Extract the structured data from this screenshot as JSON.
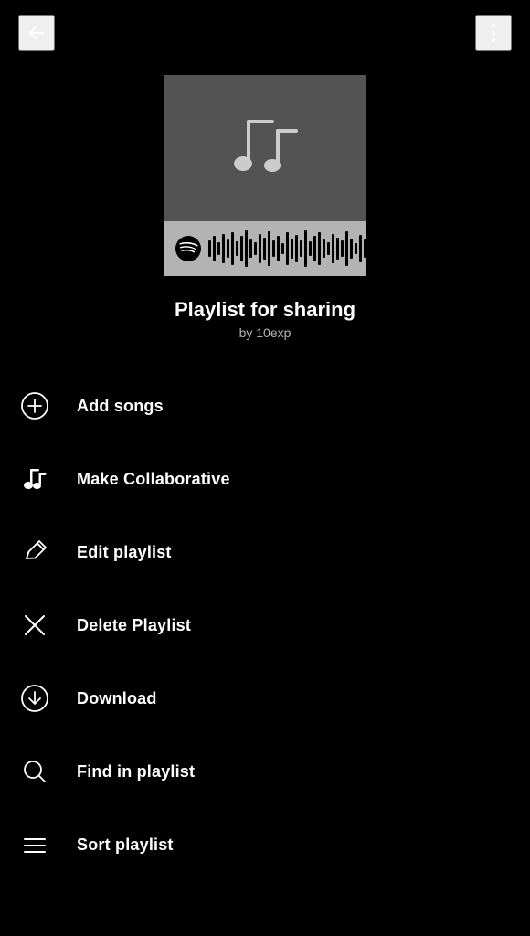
{
  "header": {
    "back_label": "Back",
    "more_label": "More options"
  },
  "playlist": {
    "title": "Playlist for sharing",
    "author": "by 10exp"
  },
  "menu": {
    "items": [
      {
        "id": "add-songs",
        "label": "Add songs",
        "icon": "add-circle-icon"
      },
      {
        "id": "make-collaborative",
        "label": "Make Collaborative",
        "icon": "music-note-icon"
      },
      {
        "id": "edit-playlist",
        "label": "Edit playlist",
        "icon": "pencil-icon"
      },
      {
        "id": "delete-playlist",
        "label": "Delete Playlist",
        "icon": "x-icon"
      },
      {
        "id": "download",
        "label": "Download",
        "icon": "download-icon"
      },
      {
        "id": "find-in-playlist",
        "label": "Find in playlist",
        "icon": "search-icon"
      },
      {
        "id": "sort-playlist",
        "label": "Sort playlist",
        "icon": "sort-icon"
      }
    ]
  }
}
